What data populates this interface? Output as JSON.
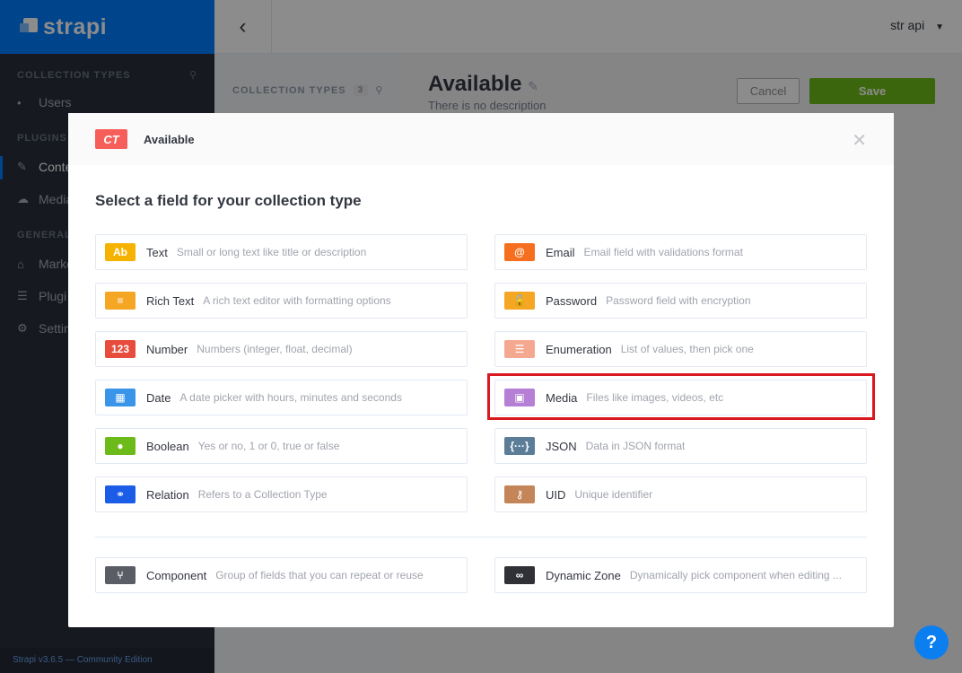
{
  "brand": {
    "name": "strapi"
  },
  "sidebar": {
    "collection_types_label": "COLLECTION TYPES",
    "collection_items": [
      "Users"
    ],
    "plugins_label": "PLUGINS",
    "plugin_items": [
      "Conte",
      "Media"
    ],
    "general_label": "GENERAL",
    "general_items": [
      "Marke",
      "Plugi",
      "Settin"
    ],
    "footer": "Strapi v3.6.5 — Community Edition"
  },
  "topbar": {
    "user": "str api"
  },
  "cbpanel": {
    "heading": "COLLECTION TYPES",
    "count": "3"
  },
  "page": {
    "title": "Available",
    "subtitle": "There is no description",
    "cancel": "Cancel",
    "save": "Save"
  },
  "modal": {
    "badge": "CT",
    "name": "Available",
    "title": "Select a field for your collection type",
    "fields": [
      {
        "name": "Text",
        "desc": "Small or long text like title or description",
        "icon": "Ab",
        "color": "#f5b300"
      },
      {
        "name": "Email",
        "desc": "Email field with validations format",
        "icon": "@",
        "color": "#f56f1f"
      },
      {
        "name": "Rich Text",
        "desc": "A rich text editor with formatting options",
        "icon": "≡",
        "color": "#f5a623"
      },
      {
        "name": "Password",
        "desc": "Password field with encryption",
        "icon": "🔓",
        "color": "#f5a623"
      },
      {
        "name": "Number",
        "desc": "Numbers (integer, float, decimal)",
        "icon": "123",
        "color": "#e74c3c"
      },
      {
        "name": "Enumeration",
        "desc": "List of values, then pick one",
        "icon": "☰",
        "color": "#f5a890"
      },
      {
        "name": "Date",
        "desc": "A date picker with hours, minutes and seconds",
        "icon": "▦",
        "color": "#3a95e8"
      },
      {
        "name": "Media",
        "desc": "Files like images, videos, etc",
        "icon": "▣",
        "color": "#b67fd6"
      },
      {
        "name": "Boolean",
        "desc": "Yes or no, 1 or 0, true or false",
        "icon": "●",
        "color": "#6dbb1a"
      },
      {
        "name": "JSON",
        "desc": "Data in JSON format",
        "icon": "{···}",
        "color": "#5b7d97"
      },
      {
        "name": "Relation",
        "desc": "Refers to a Collection Type",
        "icon": "⚭",
        "color": "#1c5de7"
      },
      {
        "name": "UID",
        "desc": "Unique identifier",
        "icon": "⚷",
        "color": "#c48558"
      }
    ],
    "bottom_fields": [
      {
        "name": "Component",
        "desc": "Group of fields that you can repeat or reuse",
        "icon": "⑂",
        "color": "#5a5d66"
      },
      {
        "name": "Dynamic Zone",
        "desc": "Dynamically pick component when editing ...",
        "icon": "∞",
        "color": "#2f3137"
      }
    ]
  },
  "help": "?"
}
